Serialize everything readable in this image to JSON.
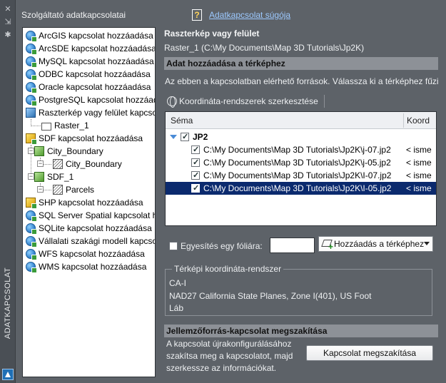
{
  "palette": {
    "vertical_title": "ADATKAPCSOLAT",
    "close_icon": "close-icon",
    "autohide_icon": "autohide-icon",
    "properties_icon": "gear-icon"
  },
  "left": {
    "title": "Szolgáltató adatkapcsolatai",
    "tree": [
      {
        "label": "ArcGIS kapcsolat hozzáadása",
        "icon": "globe"
      },
      {
        "label": "ArcSDE kapcsolat hozzáadása",
        "icon": "globe"
      },
      {
        "label": "MySQL kapcsolat hozzáadása",
        "icon": "globe"
      },
      {
        "label": "ODBC kapcsolat hozzáadása",
        "icon": "globe"
      },
      {
        "label": "Oracle kapcsolat hozzáadása",
        "icon": "globe"
      },
      {
        "label": "PostgreSQL kapcsolat hozzáad",
        "icon": "globe"
      },
      {
        "label": "Raszterkép vagy felület kapcsol",
        "icon": "raster"
      },
      {
        "label": "Raster_1",
        "icon": "folder"
      },
      {
        "label": "SDF kapcsolat hozzáadása",
        "icon": "cube"
      },
      {
        "label": "City_Boundary",
        "icon": "green"
      },
      {
        "label": "City_Boundary",
        "icon": "feat"
      },
      {
        "label": "SDF_1",
        "icon": "green"
      },
      {
        "label": "Parcels",
        "icon": "feat"
      },
      {
        "label": "SHP kapcsolat hozzáadása",
        "icon": "cube"
      },
      {
        "label": "SQL Server Spatial kapcsolat h",
        "icon": "globe"
      },
      {
        "label": "SQLite kapcsolat hozzáadása",
        "icon": "globe"
      },
      {
        "label": "Vállalati szakági modell kapcso",
        "icon": "globe"
      },
      {
        "label": "WFS kapcsolat hozzáadása",
        "icon": "globe"
      },
      {
        "label": "WMS kapcsolat hozzáadása",
        "icon": "globe"
      }
    ]
  },
  "help": {
    "icon": "help-icon",
    "link": "Adatkapcsolat súgója"
  },
  "connection": {
    "heading": "Raszterkép vagy felület",
    "value": "Raster_1 (C:\\My Documents\\Map 3D Tutorials\\Jp2K)"
  },
  "add_section": {
    "header": "Adat hozzáadása a térképhez",
    "description": "Az ebben a kapcsolatban elérhető források. Válassza ki a térképhez fűzi",
    "toolbar_button": "Koordináta-rendszerek szerkesztése",
    "grid": {
      "columns": [
        "Séma",
        "Koord"
      ],
      "group": "JP2",
      "rows": [
        {
          "path": "C:\\My Documents\\Map 3D Tutorials\\Jp2K\\j-07.jp2",
          "coord": "< isme",
          "selected": false
        },
        {
          "path": "C:\\My Documents\\Map 3D Tutorials\\Jp2K\\j-05.jp2",
          "coord": "< isme",
          "selected": false
        },
        {
          "path": "C:\\My Documents\\Map 3D Tutorials\\Jp2K\\I-07.jp2",
          "coord": "< isme",
          "selected": false
        },
        {
          "path": "C:\\My Documents\\Map 3D Tutorials\\Jp2K\\I-05.jp2",
          "coord": "< isme",
          "selected": true
        }
      ]
    },
    "merge_label": "Egyesítés egy fóliára:",
    "merge_value": "",
    "add_button": "Hozzáadás a térképhez"
  },
  "coord_system": {
    "legend": "Térképi koordináta-rendszer",
    "code": "CA-I",
    "name": "NAD27 California State Planes, Zone I(401), US Foot",
    "unit": "Láb"
  },
  "disconnect": {
    "header": "Jellemzőforrás-kapcsolat megszakítása",
    "text": "A kapcsolat újrakonfigurálásához szakítsa meg a kapcsolatot, majd szerkessze az információkat.",
    "button": "Kapcsolat megszakítása"
  }
}
